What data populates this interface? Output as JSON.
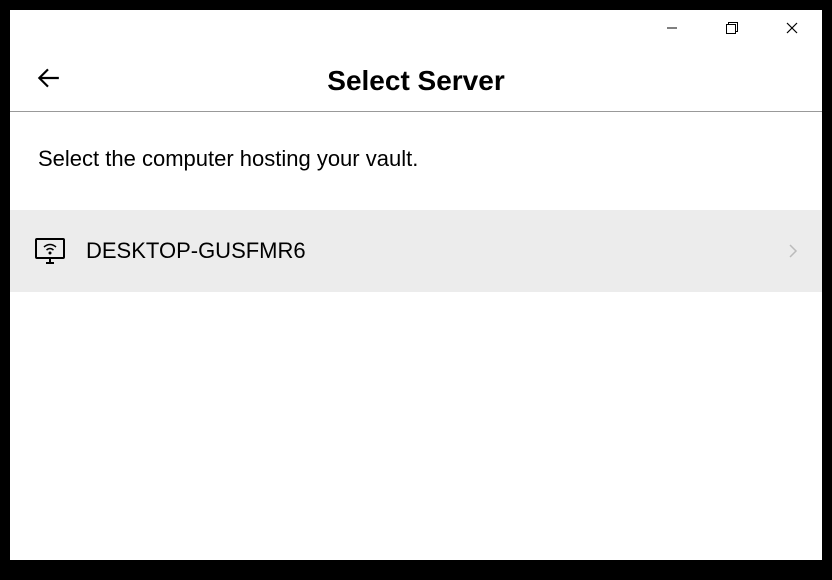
{
  "header": {
    "title": "Select Server"
  },
  "content": {
    "instruction": "Select the computer hosting your vault."
  },
  "servers": [
    {
      "name": "DESKTOP-GUSFMR6"
    }
  ]
}
